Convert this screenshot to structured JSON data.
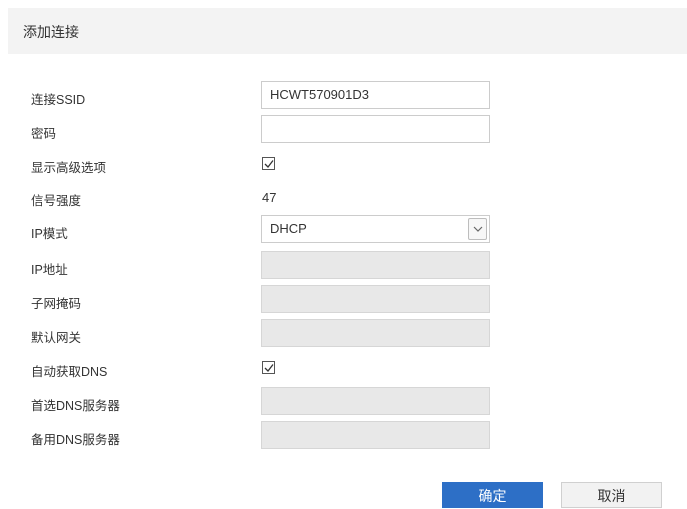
{
  "dialog": {
    "title": "添加连接"
  },
  "form": {
    "ssid": {
      "label": "连接SSID",
      "value": "HCWT570901D3"
    },
    "password": {
      "label": "密码",
      "value": ""
    },
    "show_advanced": {
      "label": "显示高级选项",
      "checked": true
    },
    "signal_strength": {
      "label": "信号强度",
      "value": "47"
    },
    "ip_mode": {
      "label": "IP模式",
      "selected": "DHCP"
    },
    "ip_address": {
      "label": "IP地址",
      "value": ""
    },
    "subnet_mask": {
      "label": "子网掩码",
      "value": ""
    },
    "gateway": {
      "label": "默认网关",
      "value": ""
    },
    "auto_dns": {
      "label": "自动获取DNS",
      "checked": true
    },
    "preferred_dns": {
      "label": "首选DNS服务器",
      "value": ""
    },
    "alternate_dns": {
      "label": "备用DNS服务器",
      "value": ""
    }
  },
  "buttons": {
    "confirm": "确定",
    "cancel": "取消"
  },
  "colors": {
    "primary_button": "#2d6fc6",
    "disabled_field": "#e8e8e8",
    "header_bg": "#f3f3f3"
  },
  "icons": {
    "checkbox": "check-icon",
    "select": "chevron-down-icon"
  }
}
